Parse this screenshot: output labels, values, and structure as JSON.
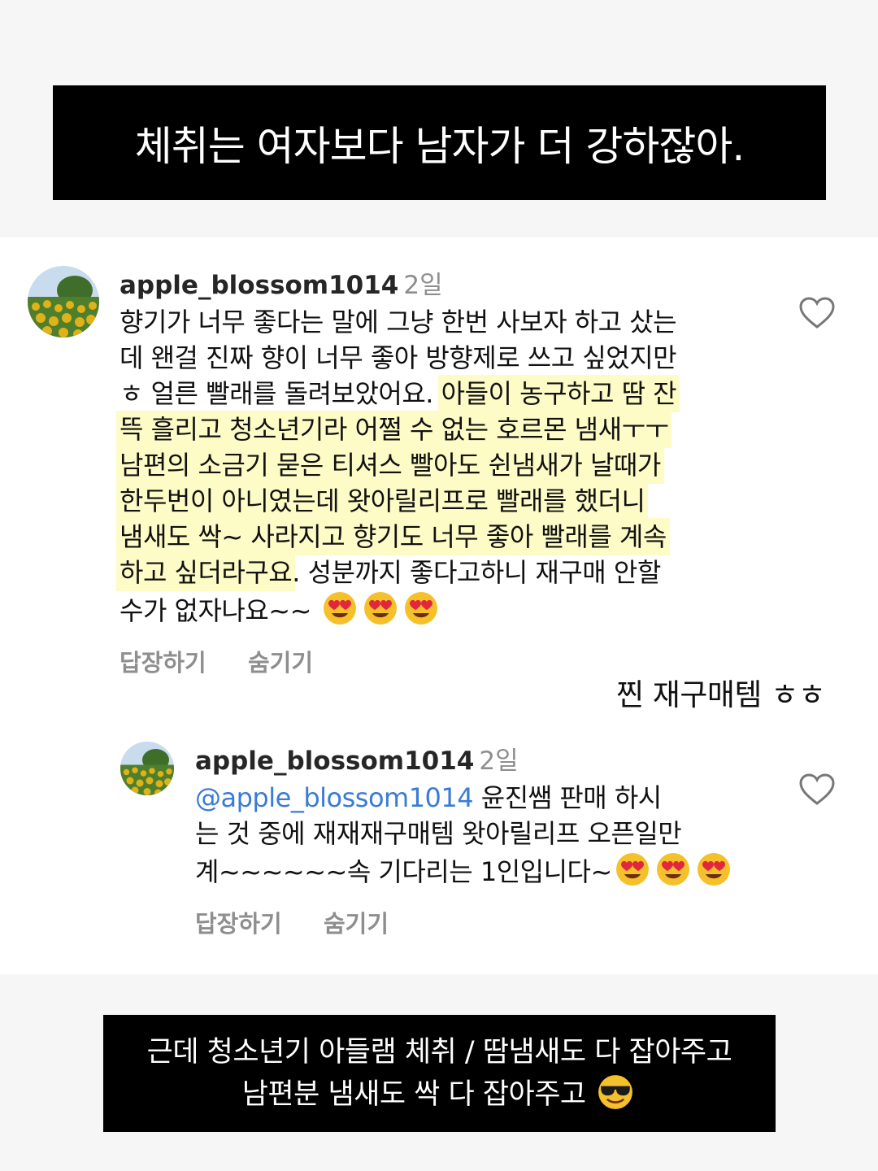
{
  "caption_top": "체취는 여자보다 남자가 더 강하잖아.",
  "comment": {
    "username": "apple_blossom1014",
    "time": "2일",
    "text_lines": [
      "향기가 너무 좋다는 말에 그냥 한번 사보자 하고 샀는",
      "데 왠걸 진짜 향이 너무 좋아 방향제로 쓰고 싶었지만",
      "ㅎ 얼른 빨래를 돌려보았어요. ",
      "아들이 농구하고 땀 잔",
      "뜩 흘리고 청소년기라 어쩔 수 없는 호르몬 냄새ㅜㅜ",
      "남편의 소금기 묻은 티셔스 빨아도 쉰냄새가 날때가",
      "한두번이 아니였는데  왓아릴리프로 빨래를 했더니",
      "냄새도 싹~  사라지고 향기도 너무 좋아 빨래를 계속",
      "하고 싶더라구요",
      ". 성분까지 좋다고하니 재구매 안할",
      "수가 없자나요~~ "
    ],
    "reply_label": "답장하기",
    "hide_label": "숨기기",
    "like_icon": "heart-outline-icon"
  },
  "side_note": "찐 재구매템 ㅎㅎ",
  "reply": {
    "username": "apple_blossom1014",
    "time": "2일",
    "mention": "@apple_blossom1014",
    "text_lines": [
      " 윤진쌤 판매 하시",
      "는 것 중에 재재재구매템 왓아릴리프 오픈일만",
      "계~~~~~~속 기다리는 1인입니다~"
    ],
    "reply_label": "답장하기",
    "hide_label": "숨기기",
    "like_icon": "heart-outline-icon"
  },
  "caption_bottom": {
    "line1": "근데 청소년기 아들램 체취 / 땀냄새도 다 잡아주고",
    "line2": "남편분 냄새도 싹 다 잡아주고 "
  },
  "colors": {
    "highlight": "#fdfbc6",
    "mention": "#3a7bd5",
    "meta_gray": "#8e8e8e"
  }
}
